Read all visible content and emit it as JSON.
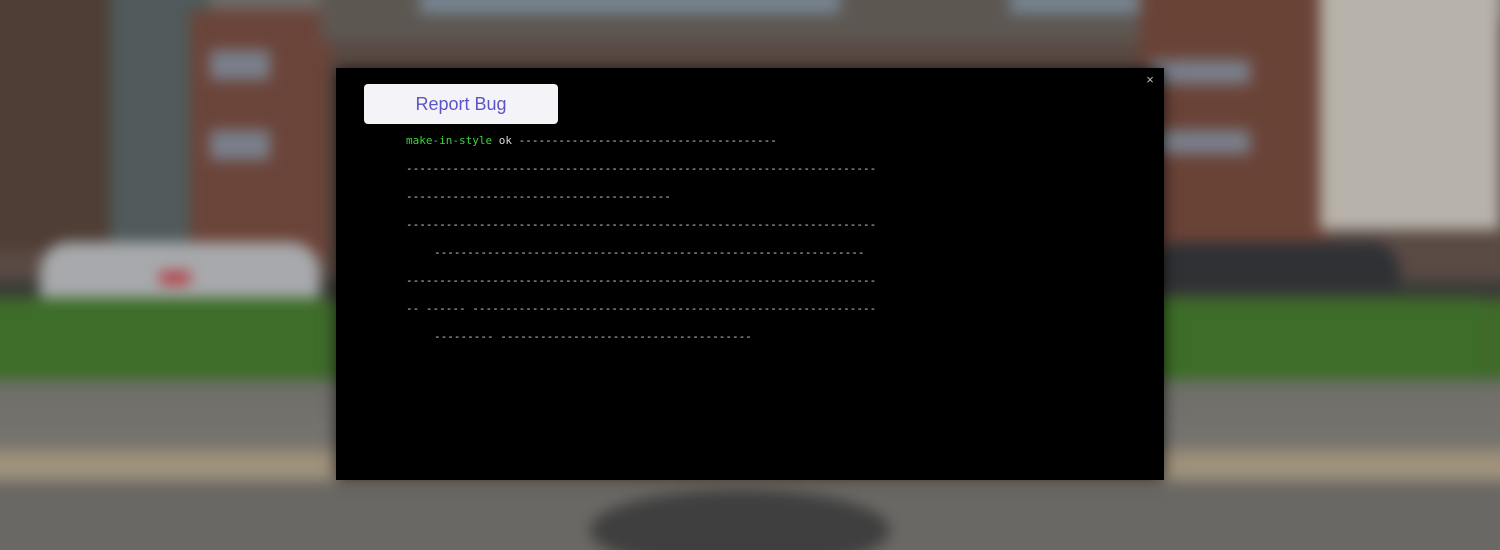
{
  "overlay": {
    "label_button": "Report Bug",
    "close_glyph": "×"
  },
  "terminal_lines": [
    {
      "highlight": "make-in-style",
      "text": " ok   ---------------------------------------"
    },
    {
      "highlight": "",
      "text": "  -----------------------------------------------------------------------"
    },
    {
      "highlight": "",
      "text": "  ----------------------------------------"
    },
    {
      "highlight": "",
      "text": "  -----------------------------------------------------------------------"
    },
    {
      "highlight": "",
      "text": "    -----------------------------------------------------------------"
    },
    {
      "highlight": "",
      "text": "  -----------------------------------------------------------------------"
    },
    {
      "highlight": "",
      "text": "  -- ------  -------------------------------------------------------------"
    },
    {
      "highlight": "",
      "text": "    ---------  --------------------------------------"
    }
  ]
}
